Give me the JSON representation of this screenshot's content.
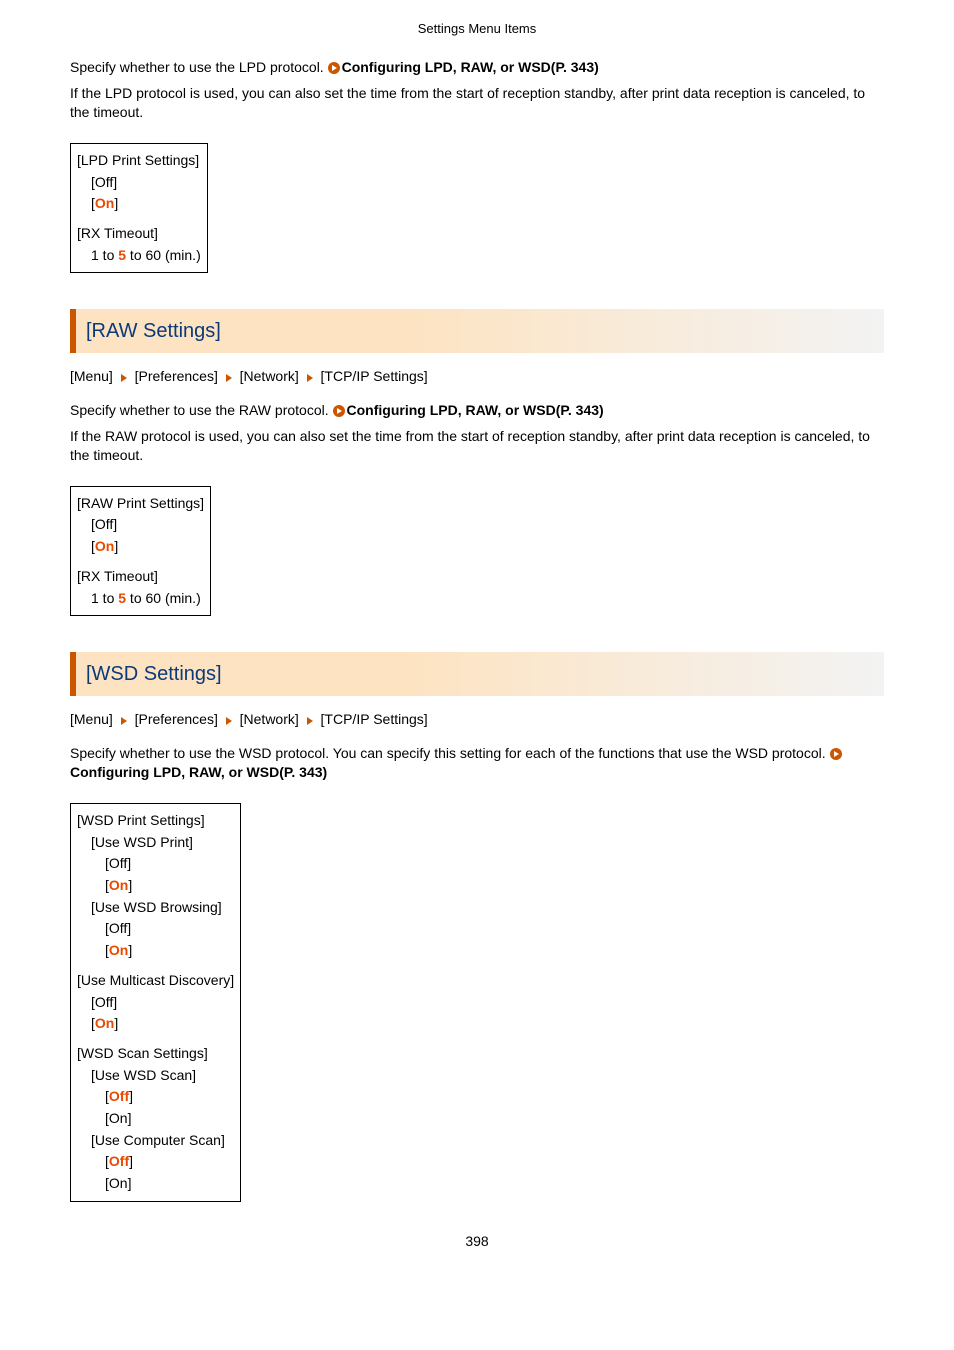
{
  "header": "Settings Menu Items",
  "pageNumber": "398",
  "xrefText": "Configuring LPD, RAW, or WSD(P. 343)",
  "intro": {
    "line1_pre": "Specify whether to use the LPD protocol. ",
    "line2": "If the LPD protocol is used, you can also set the time from the start of reception standby, after print data reception is canceled, to the timeout."
  },
  "lpdBox": {
    "title": "[LPD Print Settings]",
    "off": "[Off]",
    "on": "On",
    "rxTitle": "[RX Timeout]",
    "rxRange_pre": "1 to ",
    "rxRange_def": "5",
    "rxRange_post": " to 60 (min.)"
  },
  "rawSection": {
    "heading": "[RAW Settings]",
    "crumbs": [
      "[Menu]",
      "[Preferences]",
      "[Network]",
      "[TCP/IP Settings]"
    ],
    "line1_pre": "Specify whether to use the RAW protocol. ",
    "line2": "If the RAW protocol is used, you can also set the time from the start of reception standby, after print data reception is canceled, to the timeout.",
    "box": {
      "title": "[RAW Print Settings]",
      "off": "[Off]",
      "on": "On",
      "rxTitle": "[RX Timeout]",
      "rxRange_pre": "1 to ",
      "rxRange_def": "5",
      "rxRange_post": " to 60 (min.)"
    }
  },
  "wsdSection": {
    "heading": "[WSD Settings]",
    "crumbs": [
      "[Menu]",
      "[Preferences]",
      "[Network]",
      "[TCP/IP Settings]"
    ],
    "line1_pre": "Specify whether to use the WSD protocol. You can specify this setting for each of the functions that use the WSD protocol. ",
    "box": {
      "printTitle": "[WSD Print Settings]",
      "usePrint": "[Use WSD Print]",
      "off": "[Off]",
      "on": "On",
      "useBrowsing": "[Use WSD Browsing]",
      "multicastTitle": "[Use Multicast Discovery]",
      "scanTitle": "[WSD Scan Settings]",
      "useScan": "[Use WSD Scan]",
      "offDefault": "Off",
      "onPlain": "[On]",
      "useComputerScan": "[Use Computer Scan]"
    }
  }
}
